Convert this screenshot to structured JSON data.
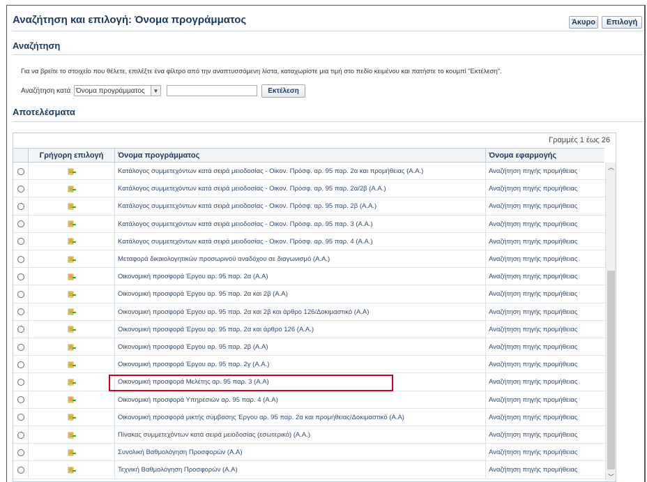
{
  "header": {
    "title": "Αναζήτηση και επιλογή: Όνομα προγράμματος",
    "cancel_label": "Άκυρο",
    "select_label": "Επιλογή"
  },
  "search": {
    "section_title": "Αναζήτηση",
    "instructions": "Για να βρείτε το στοιχείο που θέλετε, επιλέξτε ένα φίλτρο από την αναπτυσσόμενη λίστα, καταχωρίστε μια τιμή στο πεδίο κειμένου και πατήστε το κουμπί \"Εκτέλεση\".",
    "by_label": "Αναζήτηση κατά",
    "filter_value": "Όνομα προγράμματος",
    "input_value": "",
    "go_label": "Εκτέλεση"
  },
  "results": {
    "section_title": "Αποτελέσματα",
    "rows_info": "Γραμμές 1 έως 26",
    "columns": {
      "quick": "Γρήγορη επιλογή",
      "name": "Όνομα προγράμματος",
      "app": "Όνομα εφαρμογής"
    },
    "rows": [
      {
        "name": "Κατάλογος συμμετεχόντων κατά σειρά μειοδοσίας - Οικον. Πρόσφ. αρ. 95 παρ. 2α και προμήθειας (Α.Α.)",
        "app": "Αναζήτηση πηγής προμήθειας"
      },
      {
        "name": "Κατάλογος συμμετεχόντων κατά σειρά μειοδοσίας - Οικον. Πρόσφ. αρ. 95 παρ. 2α/2β (Α.Α.)",
        "app": "Αναζήτηση πηγής προμήθειας"
      },
      {
        "name": "Κατάλογος συμμετεχόντων κατά σειρά μειοδοσίας - Οικον. Πρόσφ. αρ. 95 παρ. 2β (Α.Α.)",
        "app": "Αναζήτηση πηγής προμήθειας"
      },
      {
        "name": "Κατάλογος συμμετεχόντων κατά σειρά μειοδοσίας - Οικον. Πρόσφ. αρ. 95 παρ. 3 (Α.Α.)",
        "app": "Αναζήτηση πηγής προμήθειας"
      },
      {
        "name": "Κατάλογος συμμετεχόντων κατά σειρά μειοδοσίας - Οικον. Πρόσφ. αρ. 95 παρ. 4 (Α.Α.)",
        "app": "Αναζήτηση πηγής προμήθειας"
      },
      {
        "name": "Μεταφορά δικαιολογητικών προσωρινού αναδόχου σε διαγωνισμό (Α.Α.)",
        "app": "Αναζήτηση πηγής προμήθειας"
      },
      {
        "name": "Οικονομική προσφορά Έργου αρ. 95 παρ. 2α (Α.Α)",
        "app": "Αναζήτηση πηγής προμήθειας"
      },
      {
        "name": "Οικονομική προσφορά Έργου αρ. 95 παρ. 2α και 2β (Α.Α)",
        "app": "Αναζήτηση πηγής προμήθειας"
      },
      {
        "name": "Οικονομική προσφορά Έργου αρ. 95 παρ. 2α και 2β και άρθρο 126/Δοκιμαστικό (Α.Α)",
        "app": "Αναζήτηση πηγής προμήθειας"
      },
      {
        "name": "Οικονομική προσφορά Έργου αρ. 95 παρ. 2α και άρθρο 126 (Α.Α.)",
        "app": "Αναζήτηση πηγής προμήθειας"
      },
      {
        "name": "Οικονομική προσφορά Έργου αρ. 95 παρ. 2β (Α.Α)",
        "app": "Αναζήτηση πηγής προμήθειας"
      },
      {
        "name": "Οικονομική προσφορά Έργου αρ. 95 παρ. 2γ (Α.Α.)",
        "app": "Αναζήτηση πηγής προμήθειας"
      },
      {
        "name": "Οικονομική προσφορά Μελέτης αρ. 95 παρ. 3 (Α.Α)",
        "app": "Αναζήτηση πηγής προμήθειας"
      },
      {
        "name": "Οικονομική προσφορά Υπηρεσιών αρ. 95 παρ. 4 (Α.Α)",
        "app": "Αναζήτηση πηγής προμήθειας"
      },
      {
        "name": "Οικονομική προσφορά μικτής σύμβασης Έργου αρ. 95 παρ. 2α και προμήθειας/Δοκιμαστικό (Α.Α)",
        "app": "Αναζήτηση πηγής προμήθειας"
      },
      {
        "name": "Πίνακας συμμετεχόντων κατά σειρά μειοδοσίας (εσωτερικό) (Α.Α.)",
        "app": "Αναζήτηση πηγής προμήθειας"
      },
      {
        "name": "Συνολική Βαθμολόγηση Προσφορών (Α.Α)",
        "app": "Αναζήτηση πηγής προμήθειας"
      },
      {
        "name": "Τεχνική Βαθμολόγηση Προσφορών (Α.Α)",
        "app": "Αναζήτηση πηγής προμήθειας"
      }
    ]
  },
  "icons": {
    "quick_select": "quick-select-icon",
    "dropdown": "chevron-down-icon",
    "scroll_up": "chevron-up-icon",
    "scroll_down": "chevron-down-icon"
  },
  "colors": {
    "title": "#1b3a63",
    "highlight": "#d0021b",
    "link_text": "#2e4a6e"
  }
}
